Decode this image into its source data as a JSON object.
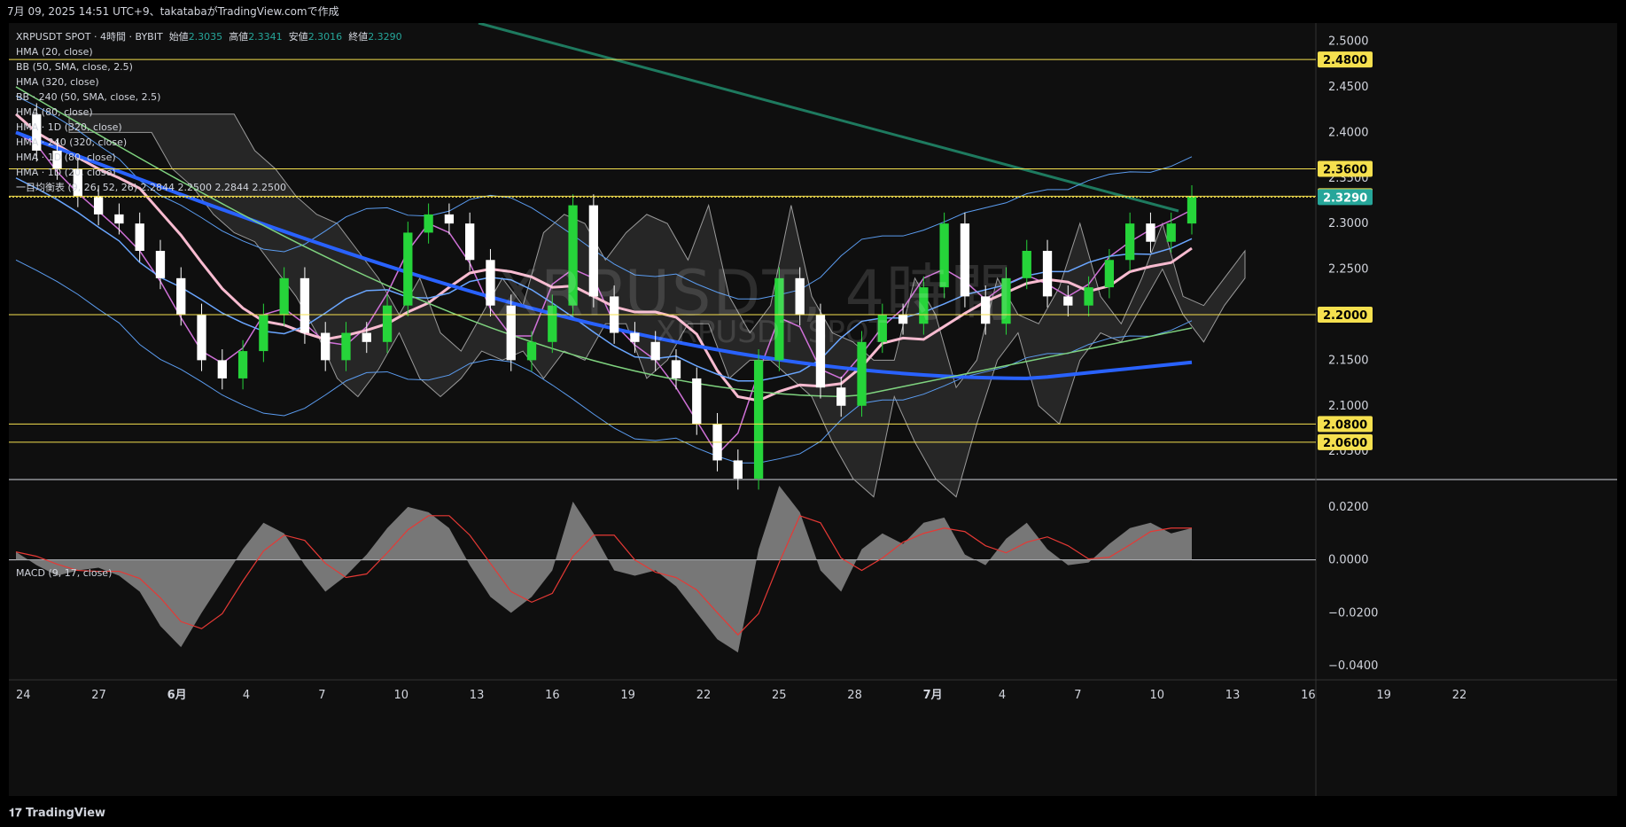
{
  "header": {
    "caption": "7月 09, 2025 14:51 UTC+9、takatabaがTradingView.comで作成"
  },
  "footer": {
    "logo": "TradingView"
  },
  "legend": {
    "symbol": "XRPUSDT SPOT · 4時間 · BYBIT",
    "open_label": "始値",
    "open": "2.3035",
    "high_label": "高値",
    "high": "2.3341",
    "low_label": "安値",
    "low": "2.3016",
    "close_label": "終値",
    "close": "2.3290",
    "indicators": [
      "HMA (20, close)",
      "BB (50, SMA, close, 2.5)",
      "HMA (320, close)",
      "BB · 240 (50, SMA, close, 2.5)",
      "HMA (80, close)",
      "HMA · 1D (320, close)",
      "HMA · 240 (320, close)",
      "HMA · 1D (80, close)",
      "HMA · 1D (20, close)",
      "一目均衡表 (9, 26, 52, 26) 2.2844 2.2500 2.2844 2.2500"
    ]
  },
  "watermark": {
    "line1": "XRPUSDT, 4時間",
    "line2": "XRPUSDT SPOT"
  },
  "colors": {
    "up": "#26d43a",
    "down": "#ffffff",
    "bb": "#5b9cf0",
    "hma20": "#d071d8",
    "hma80": "#6aa6ff",
    "hma320": "#2962ff",
    "hma1d20": "#f8bbd0",
    "hma1d80": "#7fd37f",
    "trend": "#1e7a5f",
    "level": "#f5e04f",
    "cloud": "#3a3a3a"
  },
  "chart_data": [
    {
      "type": "candlestick",
      "title": "XRPUSDT SPOT · 4時間 · BYBIT",
      "ylim": [
        2.02,
        2.52
      ],
      "y_ticks": [
        "2.5000",
        "2.4500",
        "2.4000",
        "2.3500",
        "2.3000",
        "2.2500",
        "2.2000",
        "2.1500",
        "2.1000",
        "2.0500"
      ],
      "x_ticks": [
        "24",
        "27",
        "6月",
        "4",
        "7",
        "10",
        "13",
        "16",
        "19",
        "22",
        "25",
        "28",
        "7月",
        "4",
        "7",
        "10",
        "13",
        "16",
        "19",
        "22"
      ],
      "horizontal_levels": [
        "2.4800",
        "2.3600",
        "2.3300",
        "2.2000",
        "2.0800",
        "2.0600"
      ],
      "last_price": "2.3290",
      "close_path": [
        2.42,
        2.38,
        2.36,
        2.33,
        2.31,
        2.3,
        2.27,
        2.24,
        2.2,
        2.15,
        2.13,
        2.16,
        2.2,
        2.24,
        2.18,
        2.15,
        2.18,
        2.17,
        2.21,
        2.29,
        2.31,
        2.3,
        2.26,
        2.21,
        2.15,
        2.17,
        2.21,
        2.32,
        2.22,
        2.18,
        2.17,
        2.15,
        2.13,
        2.08,
        2.04,
        2.02,
        2.15,
        2.24,
        2.2,
        2.12,
        2.1,
        2.17,
        2.2,
        2.19,
        2.23,
        2.3,
        2.22,
        2.19,
        2.24,
        2.27,
        2.22,
        2.21,
        2.23,
        2.26,
        2.3,
        2.28,
        2.3,
        2.33
      ]
    },
    {
      "type": "histogram",
      "title": "MACD (9, 17, close)",
      "ylim": [
        -0.045,
        0.03
      ],
      "y_ticks": [
        "0.0200",
        "0.0000",
        "−0.0200",
        "−0.0400"
      ],
      "values": [
        0.003,
        -0.002,
        -0.006,
        -0.004,
        -0.003,
        -0.006,
        -0.012,
        -0.025,
        -0.033,
        -0.02,
        -0.008,
        0.004,
        0.014,
        0.01,
        -0.002,
        -0.012,
        -0.006,
        0.002,
        0.012,
        0.02,
        0.018,
        0.012,
        -0.002,
        -0.014,
        -0.02,
        -0.014,
        -0.004,
        0.022,
        0.01,
        -0.004,
        -0.006,
        -0.004,
        -0.01,
        -0.02,
        -0.03,
        -0.035,
        0.004,
        0.028,
        0.018,
        -0.004,
        -0.012,
        0.004,
        0.01,
        0.006,
        0.014,
        0.016,
        0.002,
        -0.002,
        0.008,
        0.014,
        0.004,
        -0.002,
        -0.001,
        0.006,
        0.012,
        0.014,
        0.01,
        0.012
      ]
    }
  ]
}
